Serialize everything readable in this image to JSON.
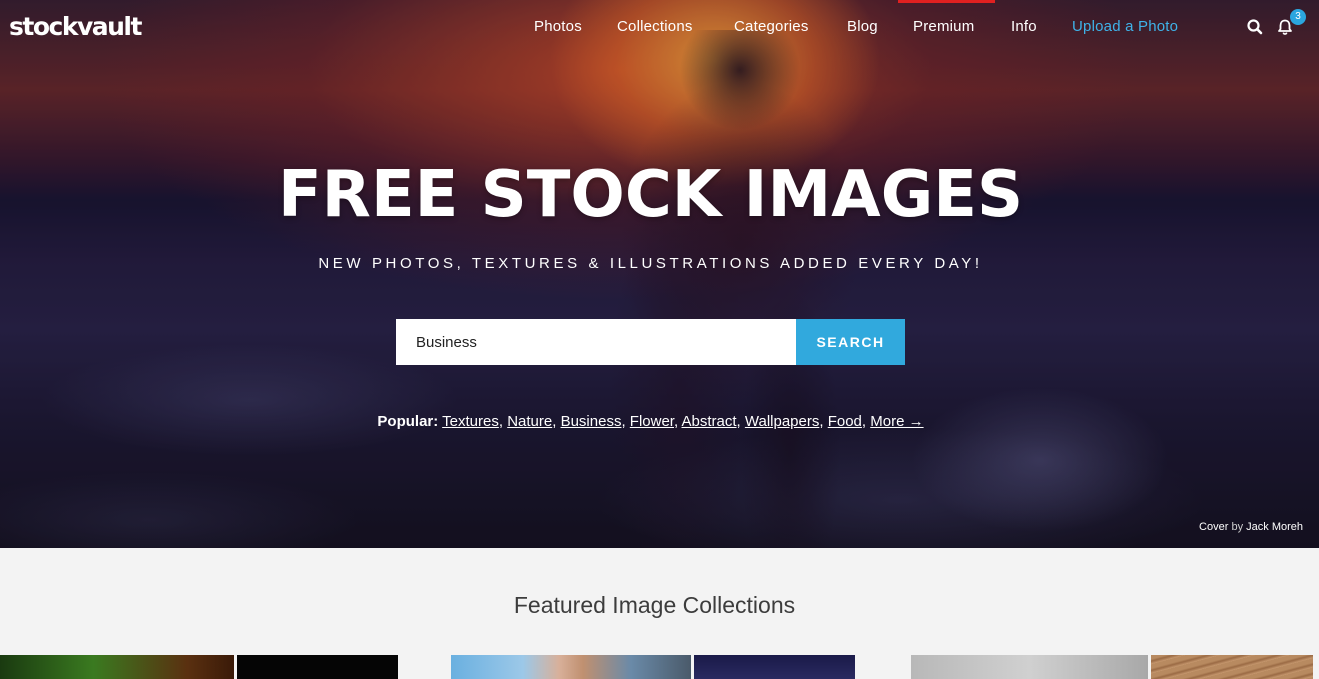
{
  "brand": {
    "logo_text": "stockvault"
  },
  "nav": {
    "items": [
      {
        "label": "Photos"
      },
      {
        "label": "Collections"
      },
      {
        "label": "Categories"
      },
      {
        "label": "Blog"
      },
      {
        "label": "Premium"
      },
      {
        "label": "Info"
      },
      {
        "label": "Upload a Photo"
      }
    ],
    "notification_count": "3",
    "icons": [
      "search-icon",
      "bell-icon"
    ],
    "active_highlight_color": "#e02020",
    "upload_color": "#3fb2e8"
  },
  "hero": {
    "title": "FREE STOCK IMAGES",
    "subtitle": "NEW PHOTOS, TEXTURES & ILLUSTRATIONS ADDED EVERY DAY!",
    "search": {
      "value": "Business",
      "button_label": "SEARCH",
      "button_color": "#31a9dd"
    },
    "popular": {
      "label": "Popular:",
      "tags": [
        "Textures",
        "Nature",
        "Business",
        "Flower",
        "Abstract",
        "Wallpapers",
        "Food"
      ],
      "more_label": "More →"
    },
    "cover_credit": {
      "prefix": "Cover",
      "by": "by",
      "author": "Jack Moreh"
    }
  },
  "featured": {
    "title": "Featured Image Collections"
  }
}
